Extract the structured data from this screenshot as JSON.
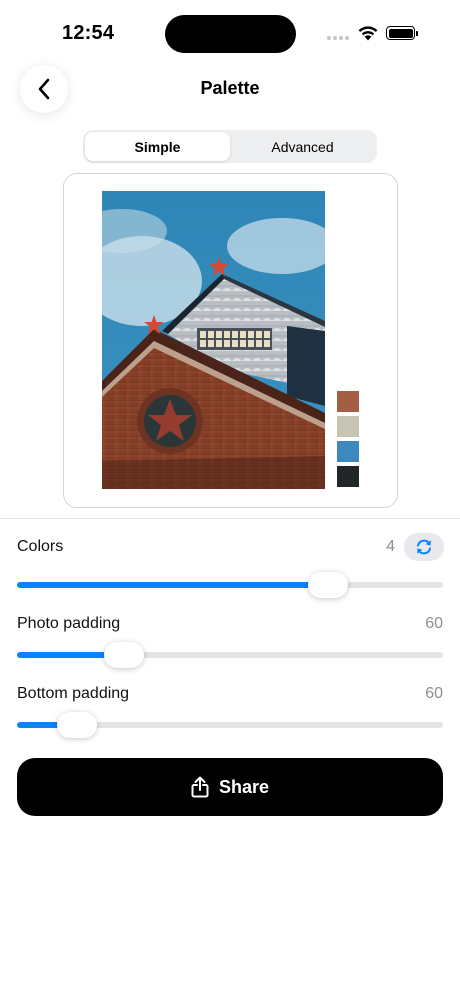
{
  "status_bar": {
    "time": "12:54"
  },
  "header": {
    "title": "Palette",
    "back_icon": "chevron-left-icon"
  },
  "segmented": {
    "options": [
      "Simple",
      "Advanced"
    ],
    "selected": "Simple"
  },
  "preview": {
    "swatches": [
      "#a35e43",
      "#c8c4b4",
      "#3d89be",
      "#212729"
    ]
  },
  "controls": {
    "colors": {
      "label": "Colors",
      "value": "4",
      "fraction": 0.73
    },
    "photo_padding": {
      "label": "Photo padding",
      "value": "60",
      "fraction": 0.25
    },
    "bottom_padding": {
      "label": "Bottom padding",
      "value": "60",
      "fraction": 0.14
    }
  },
  "share": {
    "label": "Share",
    "icon": "share-icon"
  },
  "colors": {
    "accent": "#0a84ff",
    "button_bg": "#000000"
  }
}
